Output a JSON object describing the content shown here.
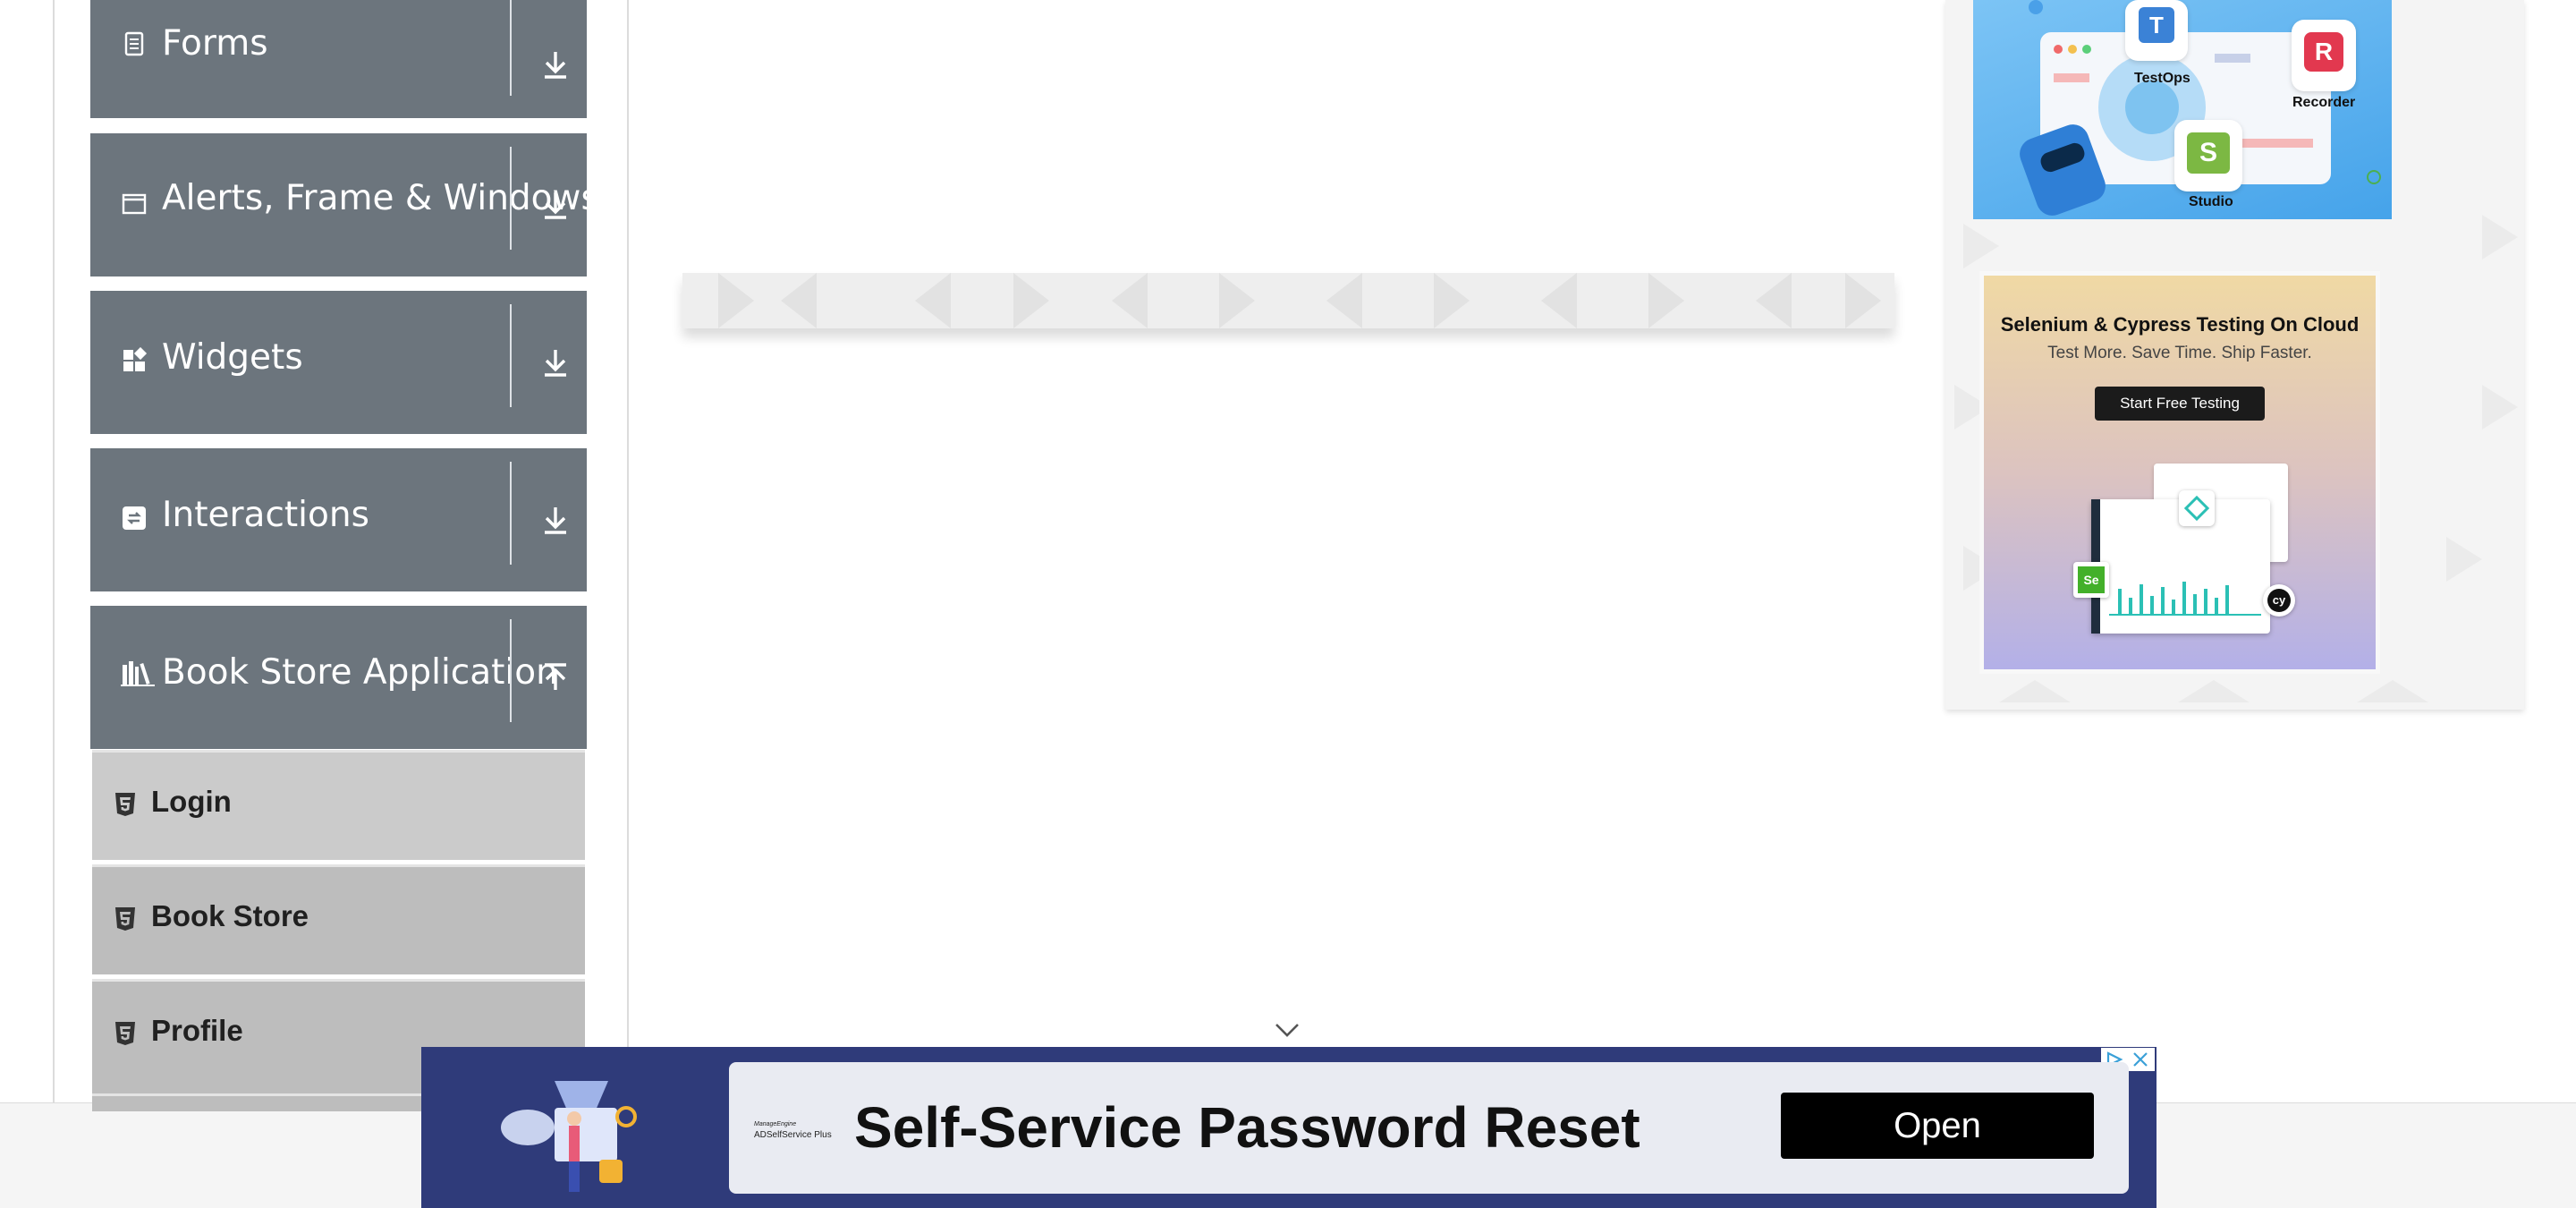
{
  "sidebar": {
    "groups": [
      {
        "label": "Forms",
        "icon": "form-icon",
        "expanded": false
      },
      {
        "label": "Alerts, Frame & Windows",
        "icon": "window-icon",
        "expanded": false
      },
      {
        "label": "Widgets",
        "icon": "widgets-icon",
        "expanded": false
      },
      {
        "label": "Interactions",
        "icon": "interactions-icon",
        "expanded": false
      },
      {
        "label": "Book Store Application",
        "icon": "books-icon",
        "expanded": true
      }
    ],
    "book_store_items": [
      {
        "label": "Login"
      },
      {
        "label": "Book Store"
      },
      {
        "label": "Profile"
      }
    ]
  },
  "right_ads": {
    "katalon": {
      "labels": [
        "TestOps",
        "Recorder",
        "Studio"
      ]
    },
    "lambdatest": {
      "title": "Selenium & Cypress Testing On Cloud",
      "subtitle": "Test More. Save Time. Ship Faster.",
      "button": "Start Free Testing"
    }
  },
  "bottom_ad": {
    "brand_line1": "ManageEngine",
    "brand_line2": "ADSelfService Plus",
    "headline": "Self-Service Password Reset",
    "cta": "Open"
  },
  "colors": {
    "sidebar_group_bg": "#6c757d",
    "sidebar_item_bg": "#bdbdbd",
    "ad_bg": "#2f3b7a",
    "ad_button_bg": "#000000"
  }
}
